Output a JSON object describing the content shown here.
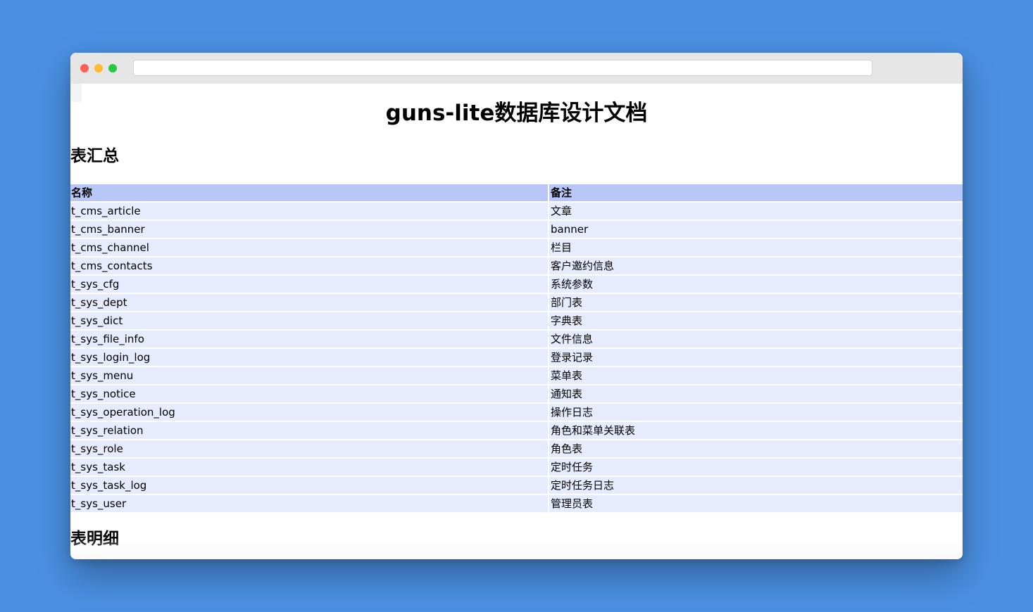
{
  "browser": {
    "url": ""
  },
  "page": {
    "title": "guns-lite数据库设计文档",
    "summary_heading": "表汇总",
    "detail_heading": "表明细"
  },
  "summary_table": {
    "columns": [
      "名称",
      "备注"
    ],
    "rows": [
      {
        "name": "t_cms_article",
        "remark": "文章"
      },
      {
        "name": "t_cms_banner",
        "remark": "banner"
      },
      {
        "name": "t_cms_channel",
        "remark": "栏目"
      },
      {
        "name": "t_cms_contacts",
        "remark": "客户邀约信息"
      },
      {
        "name": "t_sys_cfg",
        "remark": "系统参数"
      },
      {
        "name": "t_sys_dept",
        "remark": "部门表"
      },
      {
        "name": "t_sys_dict",
        "remark": "字典表"
      },
      {
        "name": "t_sys_file_info",
        "remark": "文件信息"
      },
      {
        "name": "t_sys_login_log",
        "remark": "登录记录"
      },
      {
        "name": "t_sys_menu",
        "remark": "菜单表"
      },
      {
        "name": "t_sys_notice",
        "remark": "通知表"
      },
      {
        "name": "t_sys_operation_log",
        "remark": "操作日志"
      },
      {
        "name": "t_sys_relation",
        "remark": "角色和菜单关联表"
      },
      {
        "name": "t_sys_role",
        "remark": "角色表"
      },
      {
        "name": "t_sys_task",
        "remark": "定时任务"
      },
      {
        "name": "t_sys_task_log",
        "remark": "定时任务日志"
      },
      {
        "name": "t_sys_user",
        "remark": "管理员表"
      }
    ]
  },
  "colors": {
    "desktop_background": "#4a90e2",
    "header_row": "#b8c6f8",
    "data_row": "#e6ebfd"
  }
}
